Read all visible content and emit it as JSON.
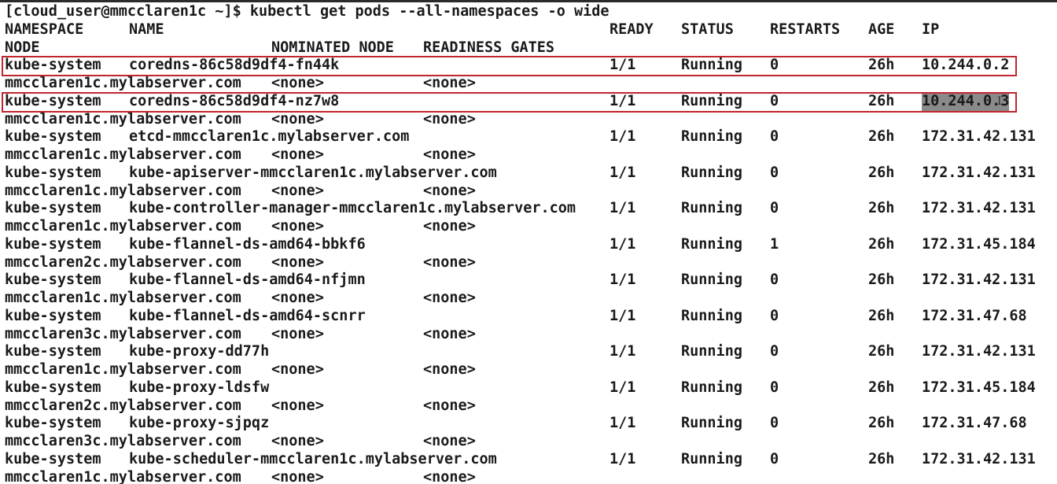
{
  "prompt": "[cloud_user@mmcclaren1c ~]$ kubectl get pods --all-namespaces -o wide",
  "headers": {
    "namespace": "NAMESPACE",
    "name": "NAME",
    "ready": "READY",
    "status": "STATUS",
    "restarts": "RESTARTS",
    "age": "AGE",
    "ip": "IP",
    "node": "NODE",
    "nominated_node": "NOMINATED NODE",
    "readiness_gates": "READINESS GATES"
  },
  "pods": [
    {
      "namespace": "kube-system",
      "name": "coredns-86c58d9df4-fn44k",
      "ready": "1/1",
      "status": "Running",
      "restarts": "0",
      "age": "26h",
      "ip": "10.244.0.2",
      "node": "mmcclaren1c.mylabserver.com",
      "nominated": "<none>",
      "gates": "<none>",
      "highlighted": true,
      "ip_selected": false
    },
    {
      "namespace": "kube-system",
      "name": "coredns-86c58d9df4-nz7w8",
      "ready": "1/1",
      "status": "Running",
      "restarts": "0",
      "age": "26h",
      "ip": "10.244.0.3",
      "node": "mmcclaren1c.mylabserver.com",
      "nominated": "<none>",
      "gates": "<none>",
      "highlighted": true,
      "ip_selected": true
    },
    {
      "namespace": "kube-system",
      "name": "etcd-mmcclaren1c.mylabserver.com",
      "ready": "1/1",
      "status": "Running",
      "restarts": "0",
      "age": "26h",
      "ip": "172.31.42.131",
      "node": "mmcclaren1c.mylabserver.com",
      "nominated": "<none>",
      "gates": "<none>",
      "highlighted": false,
      "ip_selected": false
    },
    {
      "namespace": "kube-system",
      "name": "kube-apiserver-mmcclaren1c.mylabserver.com",
      "ready": "1/1",
      "status": "Running",
      "restarts": "0",
      "age": "26h",
      "ip": "172.31.42.131",
      "node": "mmcclaren1c.mylabserver.com",
      "nominated": "<none>",
      "gates": "<none>",
      "highlighted": false,
      "ip_selected": false
    },
    {
      "namespace": "kube-system",
      "name": "kube-controller-manager-mmcclaren1c.mylabserver.com",
      "ready": "1/1",
      "status": "Running",
      "restarts": "0",
      "age": "26h",
      "ip": "172.31.42.131",
      "node": "mmcclaren1c.mylabserver.com",
      "nominated": "<none>",
      "gates": "<none>",
      "highlighted": false,
      "ip_selected": false
    },
    {
      "namespace": "kube-system",
      "name": "kube-flannel-ds-amd64-bbkf6",
      "ready": "1/1",
      "status": "Running",
      "restarts": "1",
      "age": "26h",
      "ip": "172.31.45.184",
      "node": "mmcclaren2c.mylabserver.com",
      "nominated": "<none>",
      "gates": "<none>",
      "highlighted": false,
      "ip_selected": false
    },
    {
      "namespace": "kube-system",
      "name": "kube-flannel-ds-amd64-nfjmn",
      "ready": "1/1",
      "status": "Running",
      "restarts": "0",
      "age": "26h",
      "ip": "172.31.42.131",
      "node": "mmcclaren1c.mylabserver.com",
      "nominated": "<none>",
      "gates": "<none>",
      "highlighted": false,
      "ip_selected": false
    },
    {
      "namespace": "kube-system",
      "name": "kube-flannel-ds-amd64-scnrr",
      "ready": "1/1",
      "status": "Running",
      "restarts": "0",
      "age": "26h",
      "ip": "172.31.47.68",
      "node": "mmcclaren3c.mylabserver.com",
      "nominated": "<none>",
      "gates": "<none>",
      "highlighted": false,
      "ip_selected": false
    },
    {
      "namespace": "kube-system",
      "name": "kube-proxy-dd77h",
      "ready": "1/1",
      "status": "Running",
      "restarts": "0",
      "age": "26h",
      "ip": "172.31.42.131",
      "node": "mmcclaren1c.mylabserver.com",
      "nominated": "<none>",
      "gates": "<none>",
      "highlighted": false,
      "ip_selected": false
    },
    {
      "namespace": "kube-system",
      "name": "kube-proxy-ldsfw",
      "ready": "1/1",
      "status": "Running",
      "restarts": "0",
      "age": "26h",
      "ip": "172.31.45.184",
      "node": "mmcclaren2c.mylabserver.com",
      "nominated": "<none>",
      "gates": "<none>",
      "highlighted": false,
      "ip_selected": false
    },
    {
      "namespace": "kube-system",
      "name": "kube-proxy-sjpqz",
      "ready": "1/1",
      "status": "Running",
      "restarts": "0",
      "age": "26h",
      "ip": "172.31.47.68",
      "node": "mmcclaren3c.mylabserver.com",
      "nominated": "<none>",
      "gates": "<none>",
      "highlighted": false,
      "ip_selected": false
    },
    {
      "namespace": "kube-system",
      "name": "kube-scheduler-mmcclaren1c.mylabserver.com",
      "ready": "1/1",
      "status": "Running",
      "restarts": "0",
      "age": "26h",
      "ip": "172.31.42.131",
      "node": "mmcclaren1c.mylabserver.com",
      "nominated": "<none>",
      "gates": "<none>",
      "highlighted": false,
      "ip_selected": false
    }
  ],
  "colors": {
    "background": "#ffffff",
    "text": "#1a1a1a",
    "highlight_border": "#c0262d",
    "selection": "#8a8a8a"
  },
  "icons": {
    "text_cursor": "i-beam-cursor-icon"
  }
}
